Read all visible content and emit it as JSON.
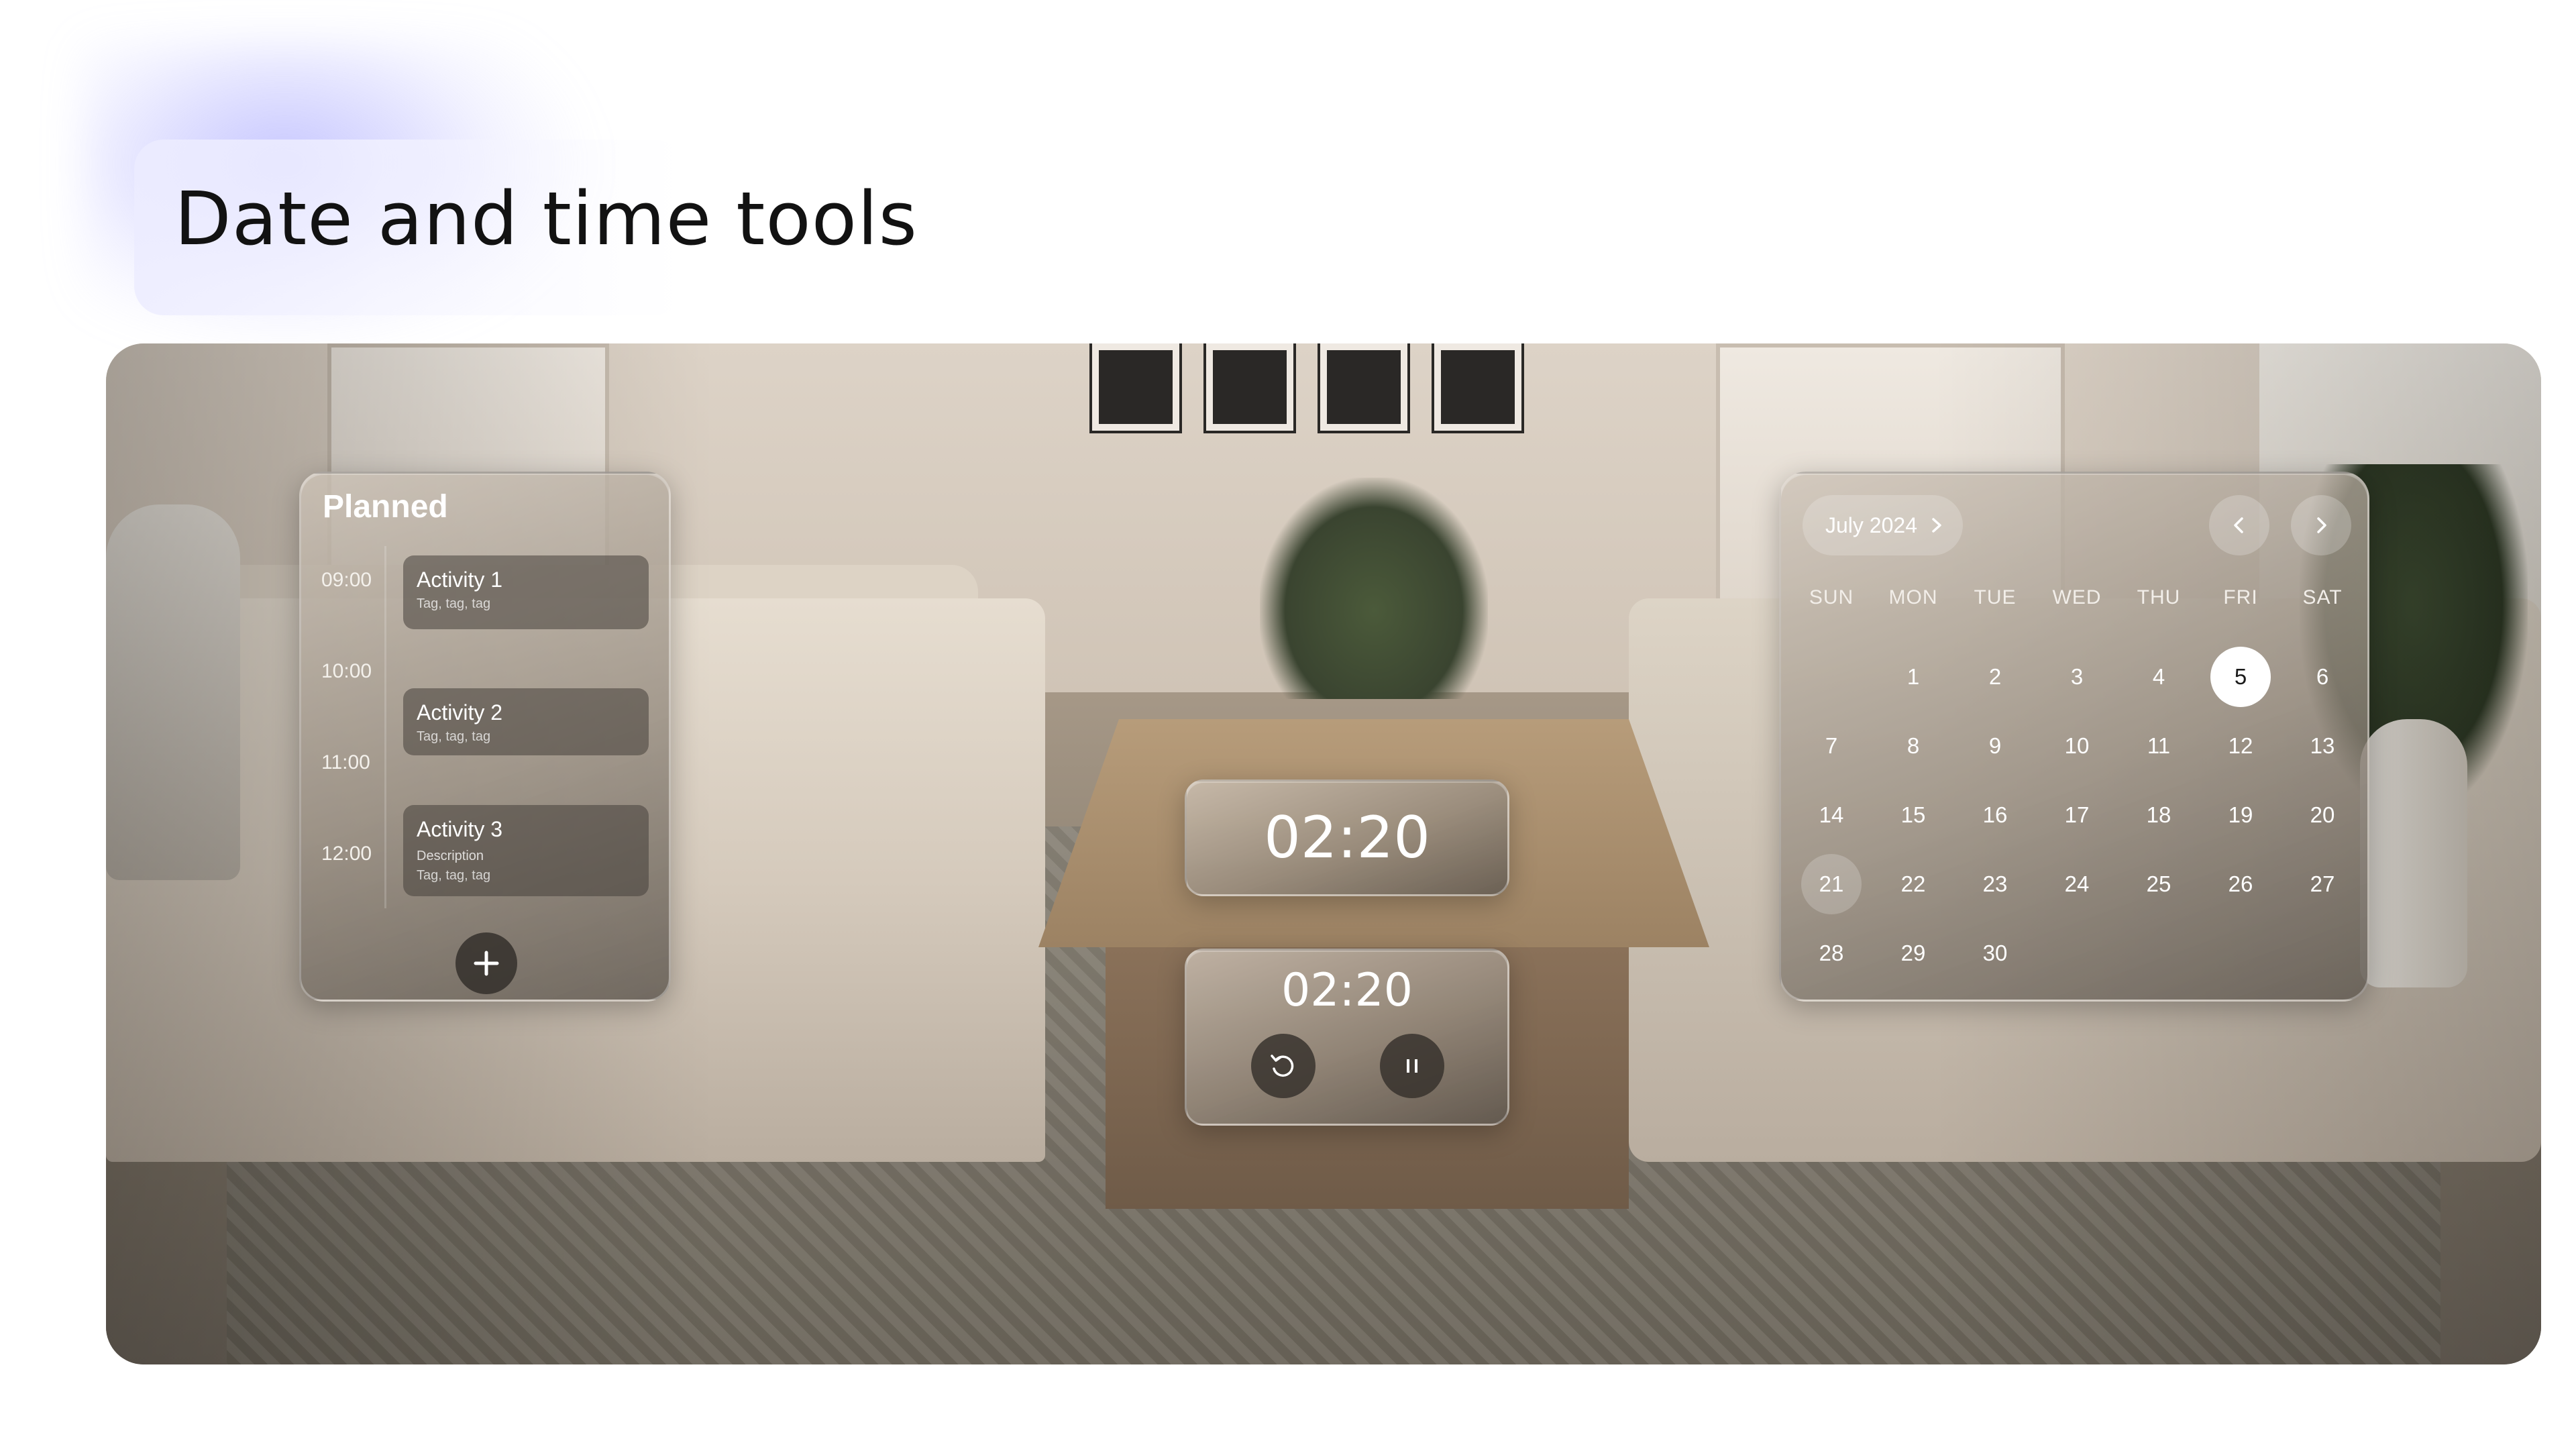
{
  "page": {
    "title": "Date and time tools"
  },
  "planner": {
    "title": "Planned",
    "times": [
      "09:00",
      "10:00",
      "11:00",
      "12:00"
    ],
    "activities": [
      {
        "title": "Activity 1",
        "description": "",
        "tags": "Tag, tag, tag"
      },
      {
        "title": "Activity 2",
        "description": "",
        "tags": "Tag, tag, tag"
      },
      {
        "title": "Activity 3",
        "description": "Description",
        "tags": "Tag, tag, tag"
      }
    ],
    "add_icon": "plus-icon"
  },
  "clock": {
    "time": "02:20"
  },
  "timer": {
    "time": "02:20",
    "reset_icon": "reset-icon",
    "pause_icon": "pause-icon"
  },
  "calendar": {
    "month": "July 2024",
    "weekdays": [
      "SUN",
      "MON",
      "TUE",
      "WED",
      "THU",
      "FRI",
      "SAT"
    ],
    "first_weekday_index": 1,
    "days_in_month": 30,
    "selected_day": 5,
    "highlighted_day": 21,
    "icons": {
      "month_chevron": "chevron-right-icon",
      "prev": "chevron-left-icon",
      "next": "chevron-right-icon"
    }
  },
  "colors": {
    "title_text": "#121212",
    "accent_glow": "#9696ff",
    "selected_day_bg": "#ffffff"
  }
}
